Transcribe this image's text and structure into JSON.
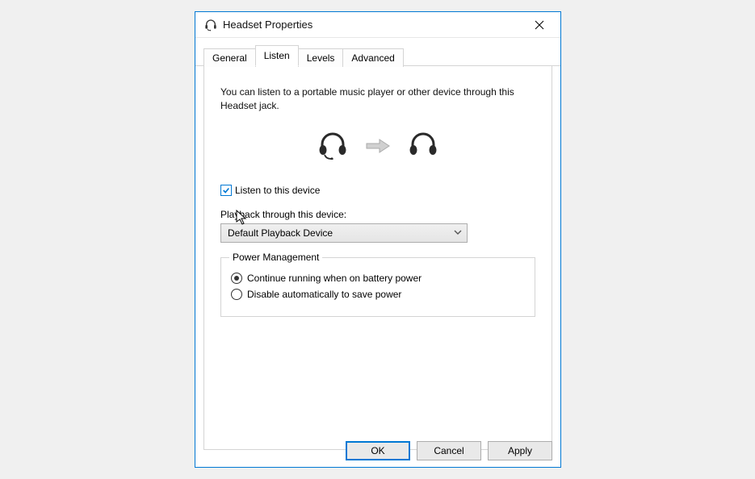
{
  "dialog": {
    "title": "Headset Properties"
  },
  "tabs": {
    "general": "General",
    "listen": "Listen",
    "levels": "Levels",
    "advanced": "Advanced",
    "active": "listen"
  },
  "listen_tab": {
    "description": "You can listen to a portable music player or other device through this Headset jack.",
    "listen_checkbox_label": "Listen to this device",
    "listen_checked": true,
    "playback_label": "Playback through this device:",
    "playback_selected": "Default Playback Device",
    "power_management": {
      "legend": "Power Management",
      "continue_label": "Continue running when on battery power",
      "disable_label": "Disable automatically to save power",
      "selected": "continue"
    }
  },
  "buttons": {
    "ok": "OK",
    "cancel": "Cancel",
    "apply": "Apply"
  }
}
